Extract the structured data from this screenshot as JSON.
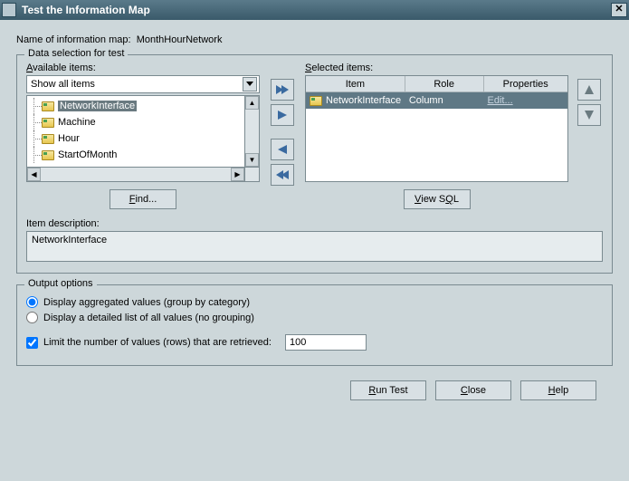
{
  "window": {
    "title": "Test the Information Map",
    "close_glyph": "✕"
  },
  "map_name_label": "Name of information map:",
  "map_name_value": "MonthHourNetwork",
  "data_selection": {
    "legend": "Data selection for test",
    "available_label": "Available items:",
    "selected_label": "Selected items:",
    "combo_value": "Show all items",
    "available_items": [
      {
        "label": "NetworkInterface",
        "selected": true
      },
      {
        "label": "Machine",
        "selected": false
      },
      {
        "label": "Hour",
        "selected": false
      },
      {
        "label": "StartOfMonth",
        "selected": false
      }
    ],
    "find_label": "Find...",
    "view_sql_label": "View SQL",
    "table": {
      "headers": {
        "item": "Item",
        "role": "Role",
        "properties": "Properties"
      },
      "rows": [
        {
          "item": "NetworkInterface",
          "role": "Column",
          "properties": "Edit..."
        }
      ]
    },
    "item_desc_label": "Item description:",
    "item_desc_value": "NetworkInterface"
  },
  "output": {
    "legend": "Output options",
    "radio_agg": "Display aggregated values (group by category)",
    "radio_detail": "Display a detailed list of all values (no grouping)",
    "limit_label": "Limit the number of values (rows) that are retrieved:",
    "limit_value": "100"
  },
  "footer": {
    "run": "Run Test",
    "close": "Close",
    "help": "Help"
  }
}
